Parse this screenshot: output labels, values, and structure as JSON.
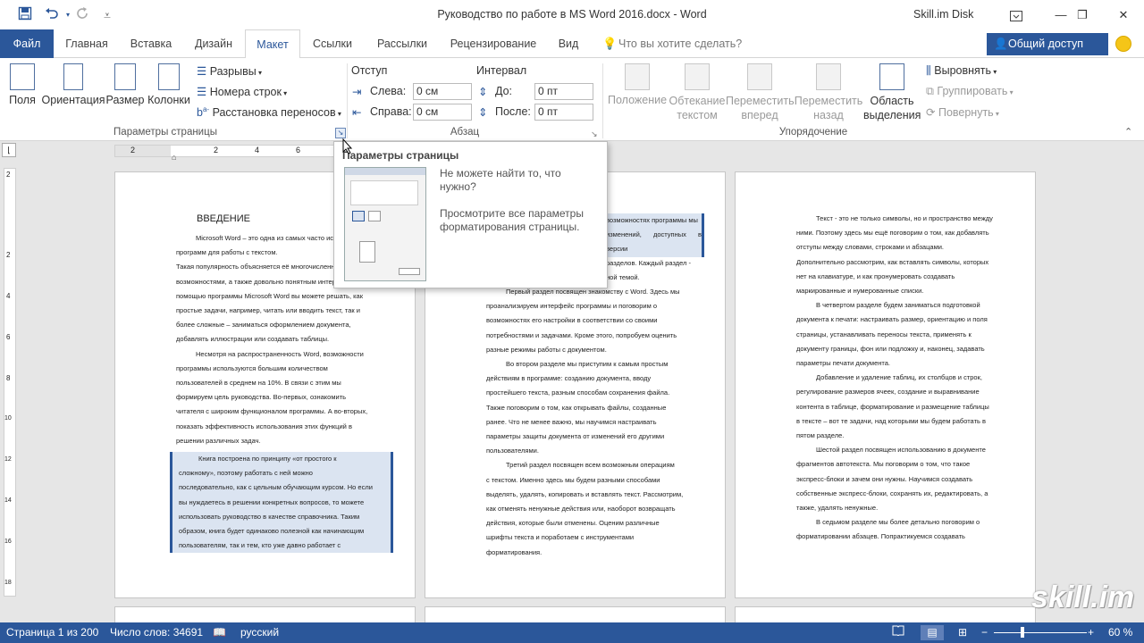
{
  "title": "Руководство по работе в MS Word 2016.docx - Word",
  "account": "Skill.im Disk",
  "tabs": [
    "Файл",
    "Главная",
    "Вставка",
    "Дизайн",
    "Макет",
    "Ссылки",
    "Рассылки",
    "Рецензирование",
    "Вид"
  ],
  "tell_me": "Что вы хотите сделать?",
  "share": "Общий доступ",
  "ribbon": {
    "page_setup": {
      "label": "Параметры страницы",
      "fields": "Поля",
      "orientation": "Ориентация",
      "size": "Размер",
      "columns": "Колонки",
      "breaks": "Разрывы",
      "line_numbers": "Номера строк",
      "hyphenation": "Расстановка переносов"
    },
    "paragraph": {
      "label": "Абзац",
      "indent": "Отступ",
      "spacing": "Интервал",
      "left": "Слева:",
      "right": "Справа:",
      "before": "До:",
      "after": "После:",
      "left_val": "0 см",
      "right_val": "0 см",
      "before_val": "0 пт",
      "after_val": "0 пт"
    },
    "arrange": {
      "label": "Упорядочение",
      "position": [
        "Положение"
      ],
      "wrap": [
        "Обтекание",
        "текстом"
      ],
      "forward": [
        "Переместить",
        "вперед"
      ],
      "backward": [
        "Переместить",
        "назад"
      ],
      "selection": [
        "Область",
        "выделения"
      ],
      "align": "Выровнять",
      "group": "Группировать",
      "rotate": "Повернуть"
    }
  },
  "tooltip": {
    "title": "Параметры страницы",
    "line1": "Не можете найти то, что нужно?",
    "line2": "Просмотрите все параметры форматирования страницы."
  },
  "pages": {
    "p1_heading": "ВВЕДЕНИЕ",
    "p1": [
      "Microsoft Word – это одна из самых часто используемых",
      "программ для работы с текстом.",
      "Такая популярность объясняется её многочисленными",
      "возможностями, а также довольно понятным интерфейсом. С",
      "помощью программы Microsoft Word вы можете решать, как",
      "простые задачи, например, читать или вводить текст, так и",
      "более сложные – заниматься оформлением документа,",
      "добавлять иллюстрации или создавать таблицы.",
      "Несмотря на распространенность Word, возможности",
      "программы используются большим количеством",
      "пользователей в среднем на 10%. В связи с этим мы",
      "формируем цель руководства. Во-первых, ознакомить",
      "читателя с широким функционалом программы. А во-вторых,",
      "показать эффективность использования этих функций в",
      "решении различных задач."
    ],
    "p1_hl": [
      "Книга построена по принципу «от простого к",
      "сложному», поэтому работать с ней можно",
      "последовательно, как с цельным обучающим курсом. Но если",
      "вы нуждаетесь в решении конкретных вопросов, то можете",
      "использовать руководство в качестве справочника. Таким",
      "образом, книга будет одинаково полезной как начинающим",
      "пользователям, так и тем, кто уже давно работает с"
    ],
    "p2_top": [
      "возможностях программы мы",
      "изменений, доступных в версии",
      "",
      "разделов. Каждый раздел -",
      "ной темой."
    ],
    "p2": [
      "Первый раздел посвящен знакомству с Word. Здесь мы",
      "проанализируем интерфейс программы и поговорим о",
      "возможностях его настройки в соответствии со своими",
      "потребностями и задачами. Кроме этого, попробуем оценить",
      "разные режимы работы с документом.",
      "Во втором разделе мы приступим к самым простым",
      "действиям в программе: созданию документа, вводу",
      "простейшего текста, разным способам сохранения файла.",
      "Также поговорим о том, как открывать файлы, созданные",
      "ранее. Что не менее важно, мы научимся настраивать",
      "параметры защиты документа от изменений его другими",
      "пользователями.",
      "Третий раздел посвящен всем возможным операциям",
      "с текстом. Именно здесь мы будем разными способами",
      "выделять, удалять, копировать и вставлять текст. Рассмотрим,",
      "как отменять ненужные действия или, наоборот возвращать",
      "действия, которые были отменены. Оценим различные",
      "шрифты текста и поработаем с инструментами",
      "форматирования."
    ],
    "p3": [
      "Текст - это не только символы, но и пространство между",
      "ними. Поэтому здесь мы ещё поговорим о том, как добавлять",
      "отступы между словами, строками и абзацами.",
      "Дополнительно рассмотрим, как вставлять символы, которых",
      "нет на клавиатуре, и как пронумеровать создавать",
      "маркированные и нумерованные списки.",
      "В четвертом разделе будем заниматься подготовкой",
      "документа к печати: настраивать размер, ориентацию и поля",
      "страницы, устанавливать переносы текста, применять к",
      "документу границы, фон или подложку и, наконец, задавать",
      "параметры печати документа.",
      "Добавление и удаление таблиц, их столбцов и строк,",
      "регулирование размеров ячеек, создание и выравнивание",
      "контента в таблице, форматирование и размещение таблицы",
      "в тексте – вот те задачи, над которыми мы будем работать в",
      "пятом разделе.",
      "Шестой раздел посвящен использованию в документе",
      "фрагментов автотекста. Мы поговорим о том, что такое",
      "экспресс-блоки и зачем они нужны. Научимся создавать",
      "собственные экспресс-блоки, сохранять их, редактировать, а",
      "также, удалять ненужные.",
      "В седьмом разделе мы более детально поговорим о",
      "форматировании абзацев. Попрактикуемся создавать"
    ]
  },
  "ruler_ticks": [
    "2",
    "2",
    "4",
    "6"
  ],
  "vruler_ticks": [
    "2",
    "2",
    "4",
    "6",
    "8",
    "10",
    "12",
    "14",
    "16",
    "18"
  ],
  "status": {
    "page": "Страница 1 из 200",
    "words": "Число слов: 34691",
    "lang": "русский",
    "zoom": "60 %"
  },
  "watermark": "skill.im",
  "colors": {
    "accent": "#2b579a"
  }
}
